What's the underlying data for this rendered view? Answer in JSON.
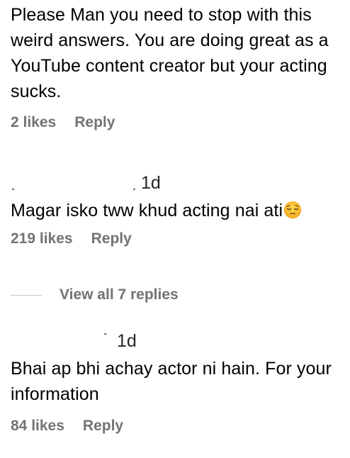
{
  "comments": [
    {
      "text": "Please Man you need to stop with this weird answers. You are doing great as a YouTube content creator but your acting sucks.",
      "likes": "2 likes",
      "reply": "Reply"
    },
    {
      "time": "1d",
      "text": "Magar isko tww khud acting nai ati",
      "emoji": "pensive-face-icon",
      "likes": "219 likes",
      "reply": "Reply"
    },
    {
      "time": "1d",
      "text": "Bhai ap bhi achay actor ni hain. For your information",
      "likes": "84 likes",
      "reply": "Reply"
    }
  ],
  "view_replies": {
    "label": "View all 7 replies"
  }
}
